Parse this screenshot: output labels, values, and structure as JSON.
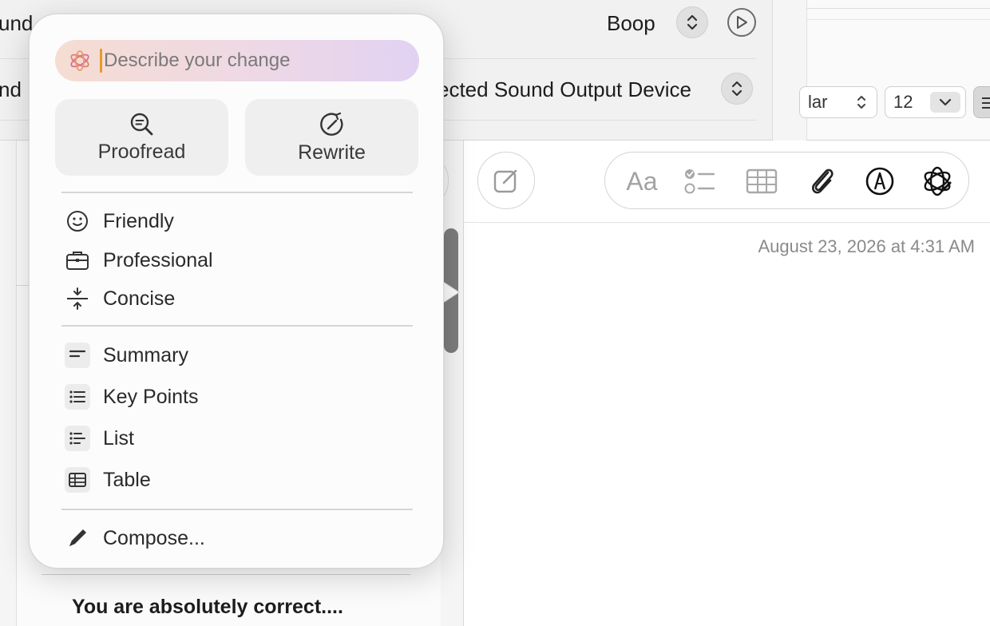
{
  "settings": {
    "row1_left": "und",
    "row1_value": "Boop",
    "row2_left": "nd",
    "row2_value": "ected Sound Output Device"
  },
  "format_bar": {
    "style_value": "lar",
    "size_value": "12"
  },
  "popover": {
    "describe_placeholder": "Describe your change",
    "proofread_label": "Proofread",
    "rewrite_label": "Rewrite",
    "tones": [
      {
        "label": "Friendly",
        "icon": "smiley-icon"
      },
      {
        "label": "Professional",
        "icon": "briefcase-icon"
      },
      {
        "label": "Concise",
        "icon": "concise-icon"
      }
    ],
    "transforms": [
      {
        "label": "Summary",
        "icon": "summary-icon"
      },
      {
        "label": "Key Points",
        "icon": "key-points-icon"
      },
      {
        "label": "List",
        "icon": "list-icon"
      },
      {
        "label": "Table",
        "icon": "table-icon"
      }
    ],
    "compose_label": "Compose..."
  },
  "notes": {
    "preview_title": "You are absolutely correct....",
    "date": "August 23, 2026 at 4:31 AM",
    "toolbar_text_style": "Aa"
  },
  "colors": {
    "accent_caret": "#e69a2a",
    "gradient_start": "#f5ddd2",
    "gradient_end": "#e2d2f2"
  }
}
